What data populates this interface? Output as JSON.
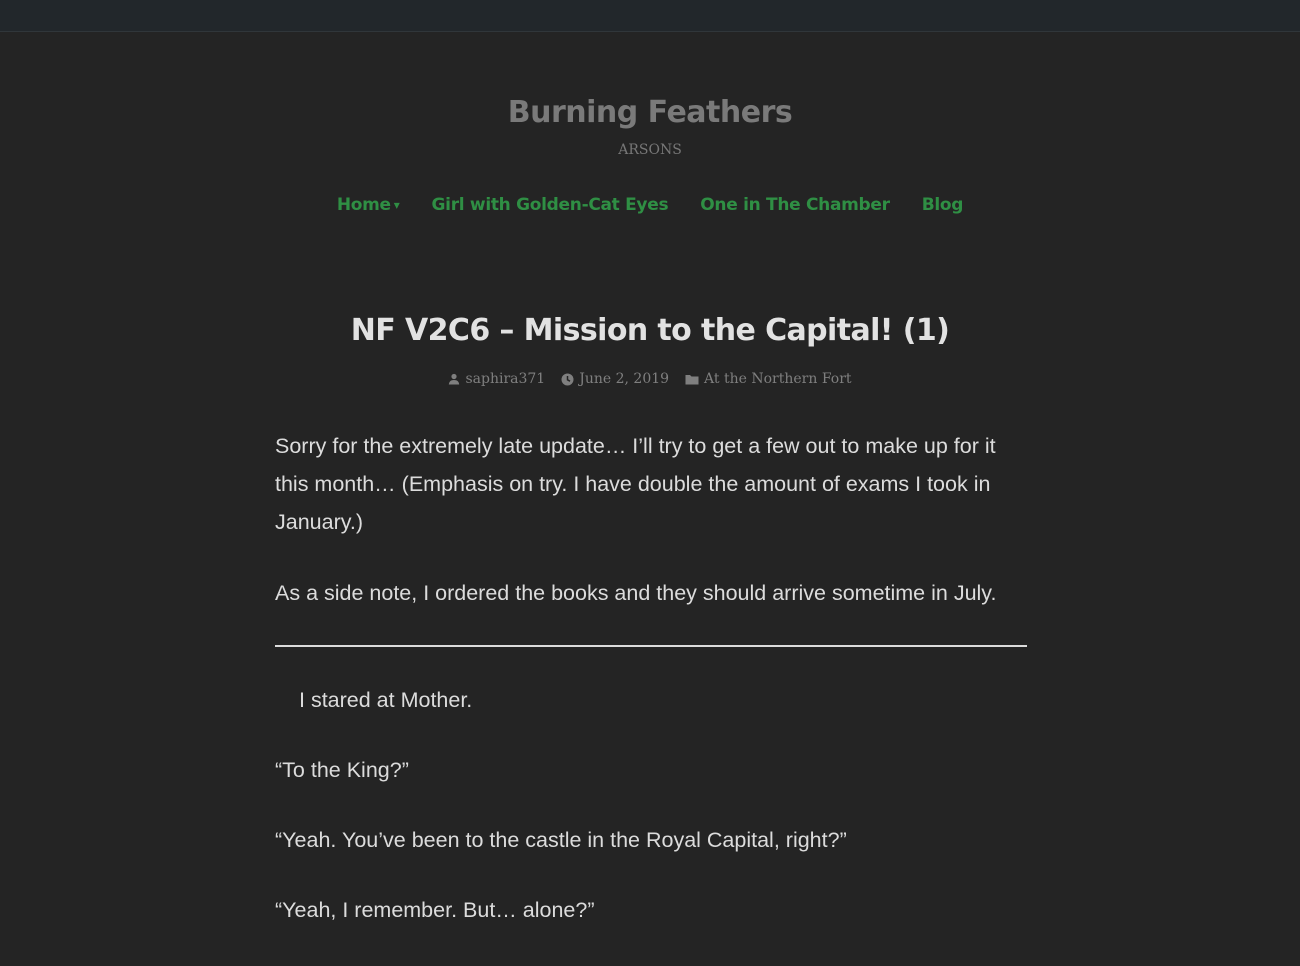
{
  "site": {
    "title": "Burning Feathers",
    "tagline": "ARSONS"
  },
  "nav": {
    "items": [
      {
        "label": "Home",
        "has_submenu": true,
        "caret": "▾"
      },
      {
        "label": "Girl with Golden-Cat Eyes"
      },
      {
        "label": "One in The Chamber"
      },
      {
        "label": "Blog"
      }
    ]
  },
  "post": {
    "title": "NF V2C6 – Mission to the Capital! (1)",
    "author": "saphira371",
    "date": "June 2, 2019",
    "category": "At the Northern Fort",
    "paragraphs": [
      "Sorry for the extremely late update… I’ll try to get a few out to make up for it this month… (Emphasis on try. I have double the amount of exams I took in January.)",
      "As a side note, I ordered the books and they should arrive sometime in July.",
      "I stared at Mother.",
      "“To the King?”",
      "“Yeah. You’ve been to the castle in the Royal Capital, right?”",
      "“Yeah, I remember. But… alone?”"
    ]
  },
  "icons": {
    "author": "person-icon",
    "date": "clock-icon",
    "category": "folder-icon"
  },
  "colors": {
    "background": "#242424",
    "topbar": "#22272b",
    "nav_link": "#2f8f44",
    "site_title": "#7a7a7a",
    "text": "#dcdcdc"
  }
}
